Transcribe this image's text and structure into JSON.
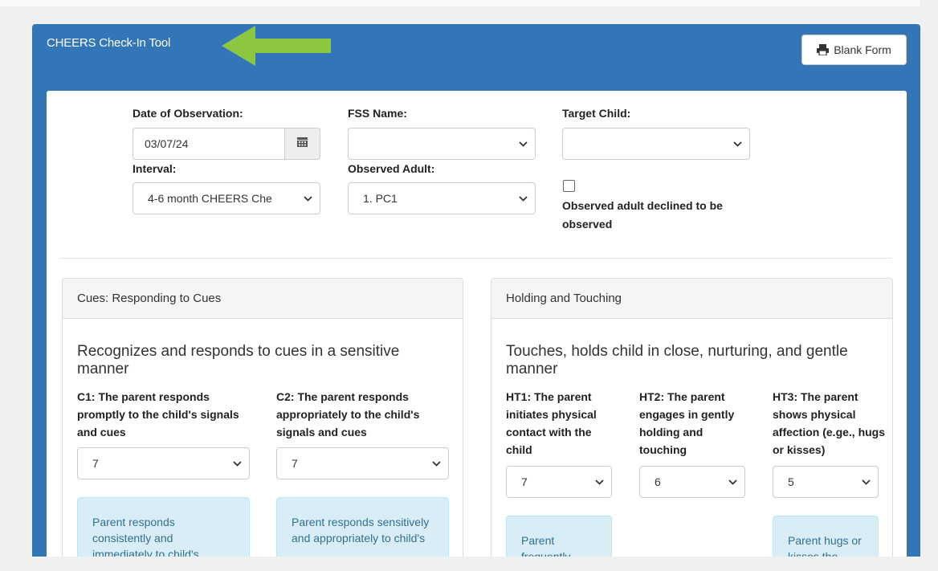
{
  "header": {
    "title": "CHEERS Check-In Tool",
    "blank_form_label": "Blank Form"
  },
  "form": {
    "date_label": "Date of Observation:",
    "date_value": "03/07/24",
    "fss_label": "FSS Name:",
    "fss_value": "",
    "target_label": "Target Child:",
    "target_value": "",
    "interval_label": "Interval:",
    "interval_value": "4-6 month CHEERS Che",
    "adult_label": "Observed Adult:",
    "adult_value": "1. PC1",
    "declined_label": "Observed adult declined to be observed",
    "declined_checked": false
  },
  "cues": {
    "heading": "Cues: Responding to Cues",
    "subheading": "Recognizes and responds to cues in a sensitive manner",
    "items": [
      {
        "label": "C1: The parent responds promptly to the child's signals and cues",
        "value": "7",
        "note": "Parent responds consistently and immediately to child's"
      },
      {
        "label": "C2: The parent responds appropriately to the child's signals and cues",
        "value": "7",
        "note": "Parent responds sensitively and appropriately to child's"
      }
    ]
  },
  "holding": {
    "heading": "Holding and Touching",
    "subheading": "Touches, holds child in close, nurturing, and gentle manner",
    "items": [
      {
        "label": "HT1: The parent initiates physical contact with the child",
        "value": "7",
        "note": "Parent frequently"
      },
      {
        "label": "HT2: The parent engages in gently holding and touching",
        "value": "6",
        "note": ""
      },
      {
        "label": "HT3: The parent shows physical affection (e.ge., hugs or kisses)",
        "value": "5",
        "note": "Parent hugs or kisses the"
      }
    ]
  },
  "colors": {
    "header_blue": "#3376b7",
    "arrow_green": "#8dc63f",
    "note_bg": "#d9edf7",
    "note_text": "#31708f"
  },
  "icons": {
    "print": "print-icon",
    "calendar": "calendar-icon",
    "chevron": "chevron-down-icon",
    "arrow": "arrow-left-icon"
  }
}
